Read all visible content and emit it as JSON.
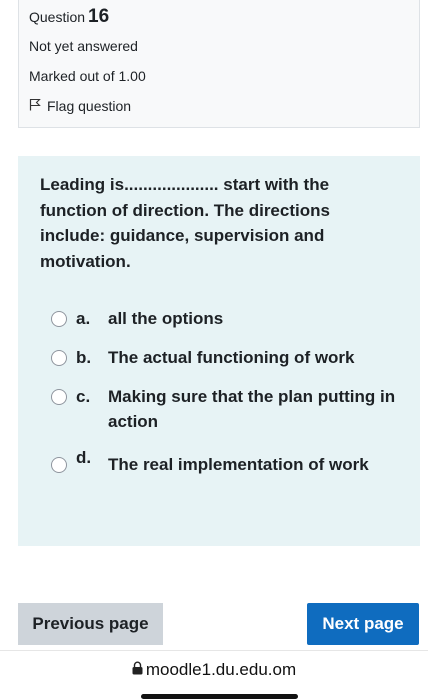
{
  "info": {
    "question_label": "Question",
    "question_number": "16",
    "state": "Not yet answered",
    "grade": "Marked out of 1.00",
    "flag_label": "Flag question"
  },
  "question": {
    "text": "Leading is.................... start with the function of direction. The directions include: guidance, supervision and motivation.",
    "options": [
      {
        "letter": "a.",
        "text": "all the options",
        "selected": false
      },
      {
        "letter": "b.",
        "text": "The actual functioning of work",
        "selected": false
      },
      {
        "letter": "c.",
        "text": "Making sure that the plan putting in action",
        "selected": false
      },
      {
        "letter": "d.",
        "text": "The real implementation of work",
        "selected": false
      }
    ]
  },
  "nav": {
    "previous_label": "Previous page",
    "next_label": "Next page"
  },
  "browser": {
    "url": "moodle1.du.edu.om",
    "lock_icon": "lock-icon"
  },
  "colors": {
    "info_bg": "#f8f9fa",
    "question_bg": "#e7f3f5",
    "next_button": "#0f6cbf",
    "prev_button": "#ced4da"
  }
}
